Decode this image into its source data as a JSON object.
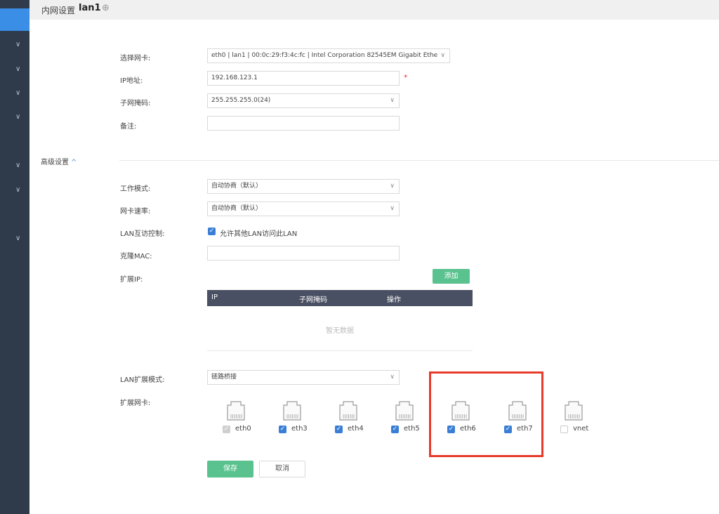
{
  "header": {
    "breadcrumb": "内网设置",
    "interface_name": "lan1",
    "add_symbol": "⊕"
  },
  "form": {
    "nic": {
      "label": "选择网卡:",
      "value": "eth0 | lan1 | 00:0c:29:f3:4c:fc | Intel Corporation 82545EM Gigabit Ethe"
    },
    "ip": {
      "label": "IP地址:",
      "value": "192.168.123.1",
      "required_mark": "*"
    },
    "mask": {
      "label": "子网掩码:",
      "value": "255.255.255.0(24)"
    },
    "note": {
      "label": "备注:",
      "value": ""
    }
  },
  "advanced": {
    "title": "高级设置",
    "caret": "^",
    "work_mode": {
      "label": "工作模式:",
      "value": "自动协商（默认）"
    },
    "nic_speed": {
      "label": "网卡速率:",
      "value": "自动协商（默认）"
    },
    "lan_access": {
      "label": "LAN互访控制:",
      "checkbox_label": "允许其他LAN访问此LAN",
      "checked": true
    },
    "clone_mac": {
      "label": "克隆MAC:",
      "value": ""
    },
    "ext_ip": {
      "label": "扩展IP:",
      "add_button": "添加",
      "columns": [
        "IP",
        "子网掩码",
        "操作"
      ],
      "empty_text": "暂无数据"
    },
    "lan_ext_mode": {
      "label": "LAN扩展模式:",
      "value": "链路桥接"
    },
    "ext_nics": {
      "label": "扩展网卡:",
      "items": [
        {
          "name": "eth0",
          "checked": true,
          "disabled": true
        },
        {
          "name": "eth3",
          "checked": true,
          "disabled": false
        },
        {
          "name": "eth4",
          "checked": true,
          "disabled": false
        },
        {
          "name": "eth5",
          "checked": true,
          "disabled": false
        },
        {
          "name": "eth6",
          "checked": true,
          "disabled": false
        },
        {
          "name": "eth7",
          "checked": true,
          "disabled": false
        },
        {
          "name": "vnet",
          "checked": false,
          "disabled": false
        }
      ]
    }
  },
  "actions": {
    "save": "保存",
    "cancel": "取消"
  },
  "colors": {
    "sidebar": "#2f3a4a",
    "accent": "#3a8ee6",
    "green": "#5ac28f",
    "highlight": "#e83a2a"
  }
}
